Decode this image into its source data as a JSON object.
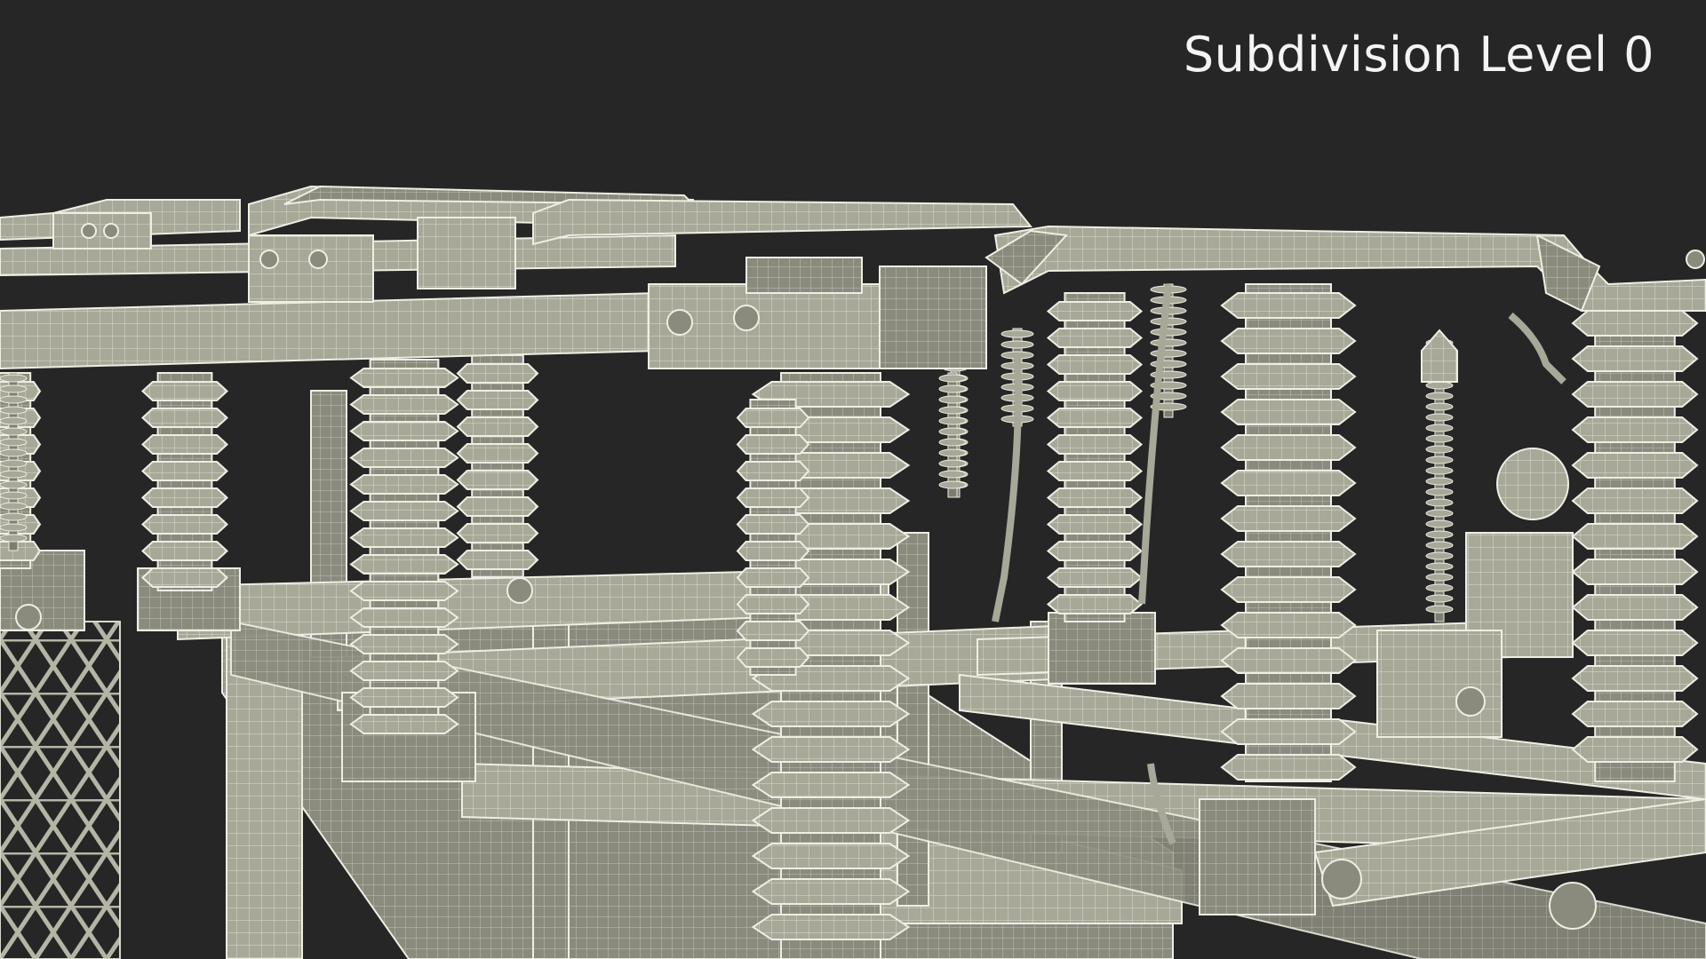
{
  "viewport": {
    "overlay_label": "Subdivision Level 0",
    "background_color": "#262626",
    "model_fill_color": "#a7a897",
    "model_dark_color": "#7d7e70",
    "wire_color": "#f2f2ea"
  }
}
